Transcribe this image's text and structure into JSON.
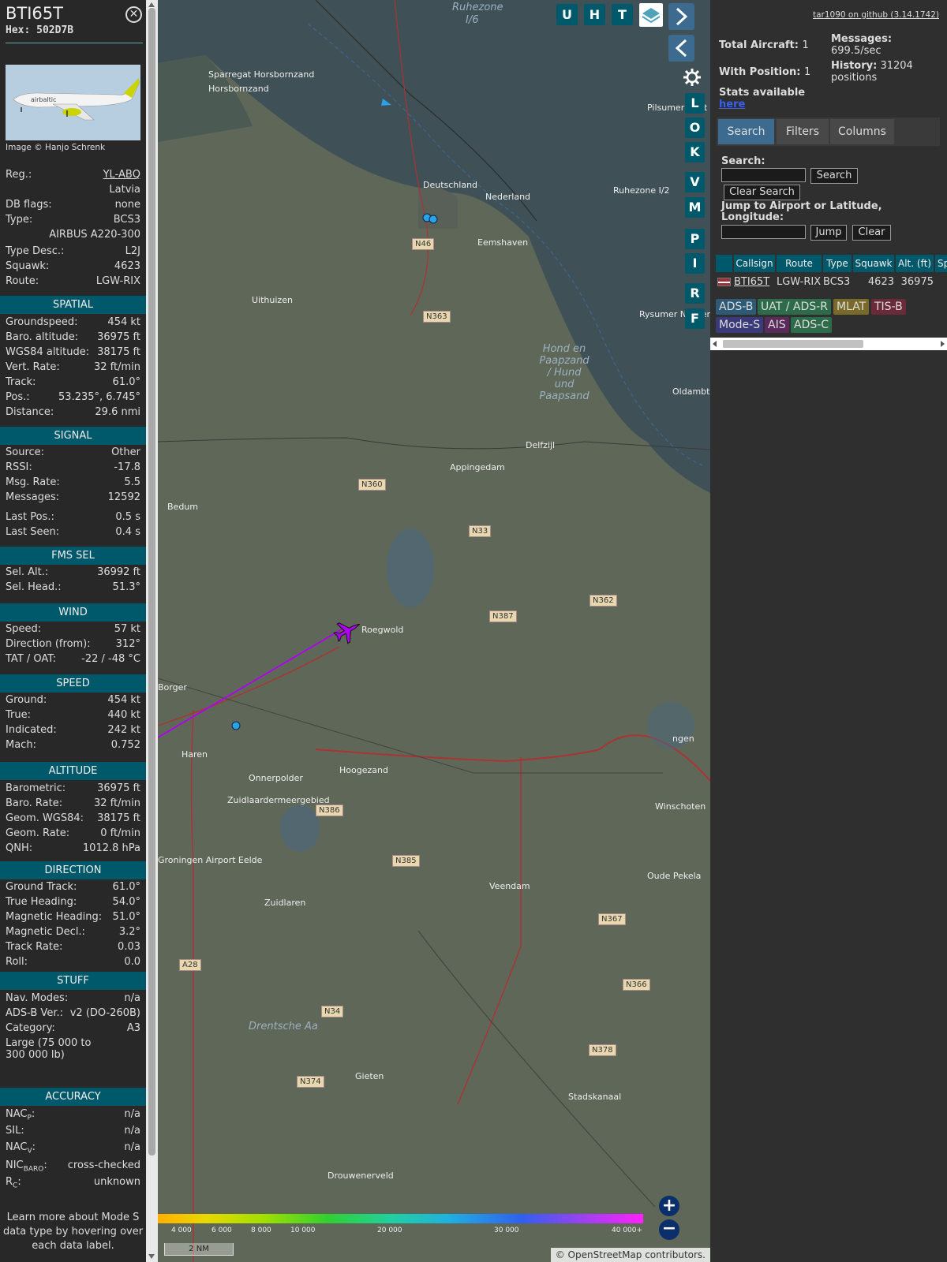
{
  "aircraft": {
    "callsign": "BTI65T",
    "hex": "Hex: 502D7B",
    "photo_credit": "Image © Hanjo Schrenk",
    "close_icon": "close-icon"
  },
  "info_rows": [
    {
      "label": "Reg.:",
      "value": "YL-ABQ"
    },
    {
      "label": "",
      "value": "Latvia"
    },
    {
      "label": "DB flags:",
      "value": "none"
    },
    {
      "label": "Type:",
      "value": "BCS3"
    },
    {
      "label": "",
      "value": "AIRBUS A220-300"
    },
    {
      "label": "Type Desc.:",
      "value": "L2J"
    },
    {
      "label": "Squawk:",
      "value": "4623"
    },
    {
      "label": "Route:",
      "value": "LGW-RIX"
    }
  ],
  "sections": {
    "spatial": {
      "title": "SPATIAL",
      "rows": [
        {
          "label": "Groundspeed:",
          "value": "454 kt"
        },
        {
          "label": "Baro. altitude:",
          "value": "36975 ft"
        },
        {
          "label": "WGS84 altitude:",
          "value": "38175 ft"
        },
        {
          "label": "Vert. Rate:",
          "value": "32 ft/min"
        },
        {
          "label": "Track:",
          "value": "61.0°"
        },
        {
          "label": "Pos.:",
          "value": "53.235°, 6.745°"
        },
        {
          "label": "Distance:",
          "value": "29.6 nmi"
        }
      ]
    },
    "signal": {
      "title": "SIGNAL",
      "rows": [
        {
          "label": "Source:",
          "value": "Other"
        },
        {
          "label": "RSSI:",
          "value": "-17.8"
        },
        {
          "label": "Msg. Rate:",
          "value": "5.5"
        },
        {
          "label": "Messages:",
          "value": "12592"
        },
        {
          "label": "Last Pos.:",
          "value": "0.5 s"
        },
        {
          "label": "Last Seen:",
          "value": "0.4 s"
        }
      ]
    },
    "fms": {
      "title": "FMS SEL",
      "rows": [
        {
          "label": "Sel. Alt.:",
          "value": "36992 ft"
        },
        {
          "label": "Sel. Head.:",
          "value": "51.3°"
        }
      ]
    },
    "wind": {
      "title": "WIND",
      "rows": [
        {
          "label": "Speed:",
          "value": "57 kt"
        },
        {
          "label": "Direction (from):",
          "value": "312°"
        },
        {
          "label": "TAT / OAT:",
          "value": "-22 / -48 °C"
        }
      ]
    },
    "speed": {
      "title": "SPEED",
      "rows": [
        {
          "label": "Ground:",
          "value": "454 kt"
        },
        {
          "label": "True:",
          "value": "440 kt"
        },
        {
          "label": "Indicated:",
          "value": "242 kt"
        },
        {
          "label": "Mach:",
          "value": "0.752"
        }
      ]
    },
    "altitude": {
      "title": "ALTITUDE",
      "rows": [
        {
          "label": "Barometric:",
          "value": "36975 ft"
        },
        {
          "label": "Baro. Rate:",
          "value": "32 ft/min"
        },
        {
          "label": "Geom. WGS84:",
          "value": "38175 ft"
        },
        {
          "label": "Geom. Rate:",
          "value": "0 ft/min"
        },
        {
          "label": "QNH:",
          "value": "1012.8 hPa"
        }
      ]
    },
    "direction": {
      "title": "DIRECTION",
      "rows": [
        {
          "label": "Ground Track:",
          "value": "61.0°"
        },
        {
          "label": "True Heading:",
          "value": "54.0°"
        },
        {
          "label": "Magnetic Heading:",
          "value": "51.0°"
        },
        {
          "label": "Magnetic Decl.:",
          "value": "3.2°"
        },
        {
          "label": "Track Rate:",
          "value": "0.03"
        },
        {
          "label": "Roll:",
          "value": "0.0"
        }
      ]
    },
    "stuff": {
      "title": "STUFF",
      "rows": [
        {
          "label": "Nav. Modes:",
          "value": "n/a"
        },
        {
          "label": "ADS-B Ver.:",
          "value": "v2 (DO-260B)"
        },
        {
          "label": "Category:",
          "value": "A3"
        }
      ],
      "category_desc_1": "Large (75 000 to",
      "category_desc_2": "300 000 lb)"
    },
    "accuracy": {
      "title": "ACCURACY",
      "rows": [
        {
          "label": "NAC",
          "sub": "P",
          "value": "n/a"
        },
        {
          "label": "SIL:",
          "sub": "",
          "value": "n/a"
        },
        {
          "label": "NAC",
          "sub": "V",
          "value": "n/a"
        },
        {
          "label": "NIC",
          "sub": "BARO",
          "value": "cross-checked"
        },
        {
          "label": "R",
          "sub": "C",
          "value": "unknown"
        }
      ]
    }
  },
  "footer": {
    "line1": "Learn more about Mode S",
    "line2": "data type by hovering over",
    "line3": "each data label."
  },
  "map_buttons": {
    "top": [
      "U",
      "H",
      "T"
    ],
    "side": [
      "L",
      "O",
      "K",
      "V",
      "M",
      "P",
      "I",
      "R",
      "F"
    ]
  },
  "map_labels": {
    "places": [
      "Ruhezone",
      "I/6",
      "Sparregat Horsbornzand",
      "Horsbornzand",
      "Deutschland",
      "Nederland",
      "Eemshaven",
      "Uithuizen",
      "Hond en Paapzand / Hund und Paapsand",
      "Delfzijl",
      "Appingedam",
      "Bedum",
      "Roegwold",
      "Haren",
      "Hoogezand",
      "Onnerpolder",
      "Zuidlaardermeergebied",
      "Winschoten",
      "Oude Pekela",
      "Veendam",
      "Zuidlaren",
      "Groningen Airport Eelde",
      "Drentsche Aa",
      "Gieten",
      "Stadskanaal",
      "Drouwenerveld",
      "Ruhezone I/2",
      "Pilsumer Watt",
      "Rysumer Nocken",
      "Oldambtmeer",
      "ngen",
      "Borger"
    ],
    "roads": [
      "N46",
      "N363",
      "N360",
      "N33",
      "N362",
      "N387",
      "N386",
      "N385",
      "N367",
      "N366",
      "N378",
      "A28",
      "N34",
      "N374"
    ]
  },
  "color_scale": {
    "ticks": [
      "4 000",
      "6 000",
      "8 000",
      "10 000",
      "20 000",
      "30 000",
      "40 000+"
    ]
  },
  "scale_bar": "2 NM",
  "attribution": "© OpenStreetMap contributors.",
  "panel": {
    "link": "tar1090 on github (3.14.1742)",
    "total_aircraft_label": "Total Aircraft:",
    "total_aircraft": "1",
    "with_position_label": "With Position:",
    "with_position": "1",
    "messages_label": "Messages:",
    "messages": "699.5/sec",
    "history_label": "History:",
    "history": "31204",
    "history_unit": "positions",
    "stats_text": "Stats available",
    "stats_link": "here",
    "tabs": [
      "Search",
      "Filters",
      "Columns"
    ],
    "search_label": "Search:",
    "search_button": "Search",
    "clear_search_button": "Clear Search",
    "jump_label": "Jump to Airport or Latitude, Longitude:",
    "jump_button": "Jump",
    "clear_button": "Clear",
    "columns": [
      "Callsign",
      "Route",
      "Type",
      "Squawk",
      "Alt. (ft)",
      "Sp"
    ],
    "row": {
      "callsign": "BTI65T",
      "route": "LGW-RIX",
      "type": "BCS3",
      "squawk": "4623",
      "alt": "36975"
    },
    "sources": [
      {
        "name": "ADS-B",
        "color": "#2e5a77"
      },
      {
        "name": "UAT / ADS-R",
        "color": "#2e6b4a"
      },
      {
        "name": "MLAT",
        "color": "#7a6a2a"
      },
      {
        "name": "TIS-B",
        "color": "#6a2a3a"
      },
      {
        "name": "Mode-S",
        "color": "#3a3a7a"
      },
      {
        "name": "AIS",
        "color": "#5a2a5a"
      },
      {
        "name": "ADS-C",
        "color": "#2e6b4a"
      }
    ]
  }
}
